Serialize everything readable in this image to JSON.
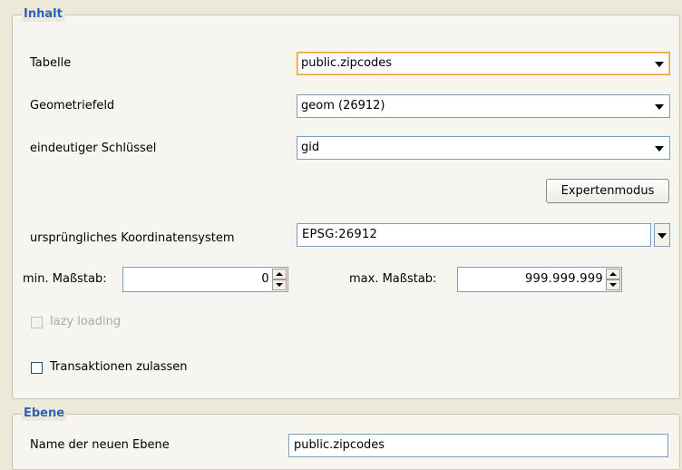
{
  "inhalt": {
    "legend": "Inhalt",
    "table_label": "Tabelle",
    "table_value": "public.zipcodes",
    "geometry_label": "Geometriefeld",
    "geometry_value": "geom (26912)",
    "key_label": "eindeutiger Schlüssel",
    "key_value": "gid",
    "expert_button": "Expertenmodus",
    "crs_label": "ursprüngliches Koordinatensystem",
    "crs_value": "EPSG:26912",
    "min_scale_label": "min. Maßstab:",
    "min_scale_value": "0",
    "max_scale_label": "max. Maßstab:",
    "max_scale_value": "999.999.999",
    "lazy_loading_label": "lazy loading",
    "lazy_loading_checked": false,
    "lazy_loading_enabled": false,
    "transactions_label": "Transaktionen zulassen",
    "transactions_checked": false
  },
  "ebene": {
    "legend": "Ebene",
    "layer_name_label": "Name der neuen Ebene",
    "layer_name_value": "public.zipcodes"
  },
  "colors": {
    "legend_text": "#2d5fbd",
    "focus_border": "#e3a23a",
    "panel_bg": "#ece9d8",
    "field_border": "#7f9db9"
  }
}
